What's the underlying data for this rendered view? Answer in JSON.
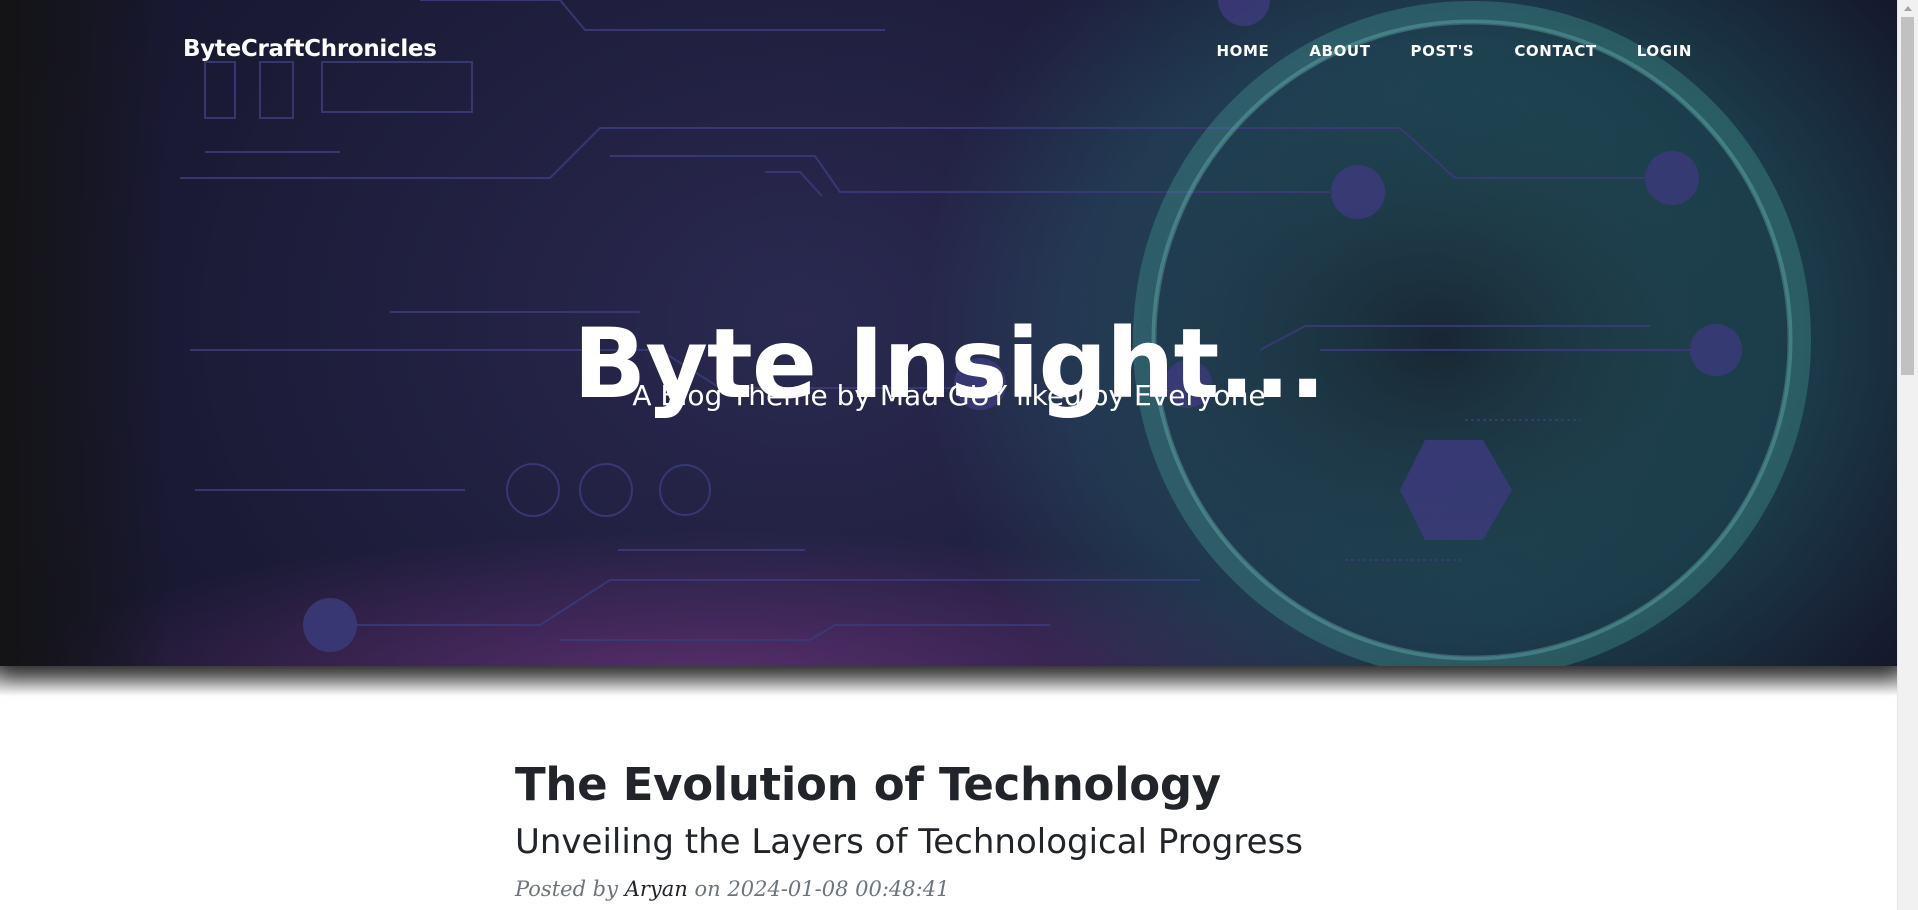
{
  "header": {
    "brand": "ByteCraftChronicles",
    "nav": [
      {
        "label": "HOME"
      },
      {
        "label": "ABOUT"
      },
      {
        "label": "POST'S"
      },
      {
        "label": "CONTACT"
      },
      {
        "label": "LOGIN"
      }
    ]
  },
  "hero": {
    "title": "Byte Insight...",
    "subtitle": "A Blog Theme by Mad GUY liked by Everyone"
  },
  "post": {
    "title": "The Evolution of Technology",
    "subtitle": "Unveiling the Layers of Technological Progress",
    "meta_prefix": "Posted by",
    "author": "Aryan",
    "meta_on": "on",
    "date": "2024-01-08 00:48:41"
  },
  "colors": {
    "hero_base": "#1e1d3c",
    "hero_teal_glow": "#32aaa0",
    "hero_magenta_glow": "#8c3c96",
    "circuit_line": "#3a3a78",
    "text_dark": "#212529",
    "text_muted": "#6c757d"
  }
}
